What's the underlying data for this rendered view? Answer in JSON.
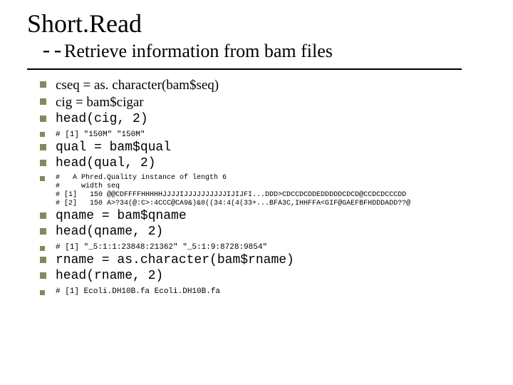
{
  "title": "Short.Read",
  "dashes": "--",
  "subtitle": "Retrieve information from bam files",
  "block1": {
    "l1": "cseq = as. character(bam$seq)",
    "l2": "cig = bam$cigar",
    "l3": "head(cig, 2)",
    "o1": "# [1] \"150M\" \"150M\""
  },
  "block2": {
    "l1": "qual = bam$qual",
    "l2": "head(qual, 2)",
    "o1": "#   A Phred.Quality instance of length 6",
    "o2": "#     width seq",
    "o3": "# [1]   150 @@CDFFFFHHHHHJJJJIJJJJJJJJJJIJIJFI...DDD>CDCCDCDDEDDDDDCDCD@CCDCDCCCDD",
    "o4": "# [2]   150 A>?34(@:C>:4CCC@CA9&)&0((34:4(4(33+...BFA3C,IHHFFA<GIF@GAEFBFHDDDADD??@"
  },
  "block3": {
    "l1": "qname = bam$qname",
    "l2": "head(qname, 2)",
    "o1": "# [1] \"_5:1:1:23848:21362\" \"_5:1:9:8728:9854\""
  },
  "block4": {
    "l1": "rname = as.character(bam$rname)",
    "l2": "head(rname, 2)",
    "o1": "# [1] Ecoli.DH10B.fa Ecoli.DH10B.fa"
  }
}
